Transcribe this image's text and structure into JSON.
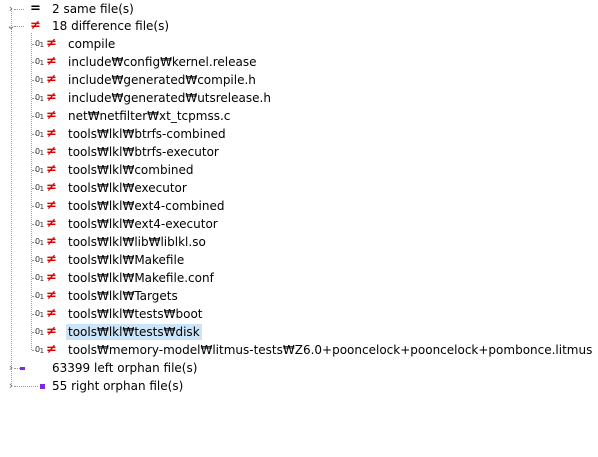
{
  "groups": {
    "same": {
      "label": "2 same file(s)"
    },
    "diff": {
      "label": "18 difference file(s)"
    },
    "left_orphan": {
      "label": "63399 left orphan file(s)"
    },
    "right_orphan": {
      "label": "55 right orphan file(s)"
    }
  },
  "diff_files": [
    "compile",
    "include₩config₩kernel.release",
    "include₩generated₩compile.h",
    "include₩generated₩utsrelease.h",
    "net₩netfilter₩xt_tcpmss.c",
    "tools₩lkl₩btrfs-combined",
    "tools₩lkl₩btrfs-executor",
    "tools₩lkl₩combined",
    "tools₩lkl₩executor",
    "tools₩lkl₩ext4-combined",
    "tools₩lkl₩ext4-executor",
    "tools₩lkl₩lib₩liblkl.so",
    "tools₩lkl₩Makefile",
    "tools₩lkl₩Makefile.conf",
    "tools₩lkl₩Targets",
    "tools₩lkl₩tests₩boot",
    "tools₩lkl₩tests₩disk",
    "tools₩memory-model₩litmus-tests₩Z6.0+pooncelock+pooncelock+pombonce.litmus"
  ],
  "selected_index": 16,
  "icons": {
    "same": "equal-icon",
    "diff": "not-equal-icon",
    "file_marker": "binary-01-icon",
    "orphan_color": "#7c2ae0",
    "diff_color": "#e00000",
    "selection_color": "#cce4f7"
  }
}
